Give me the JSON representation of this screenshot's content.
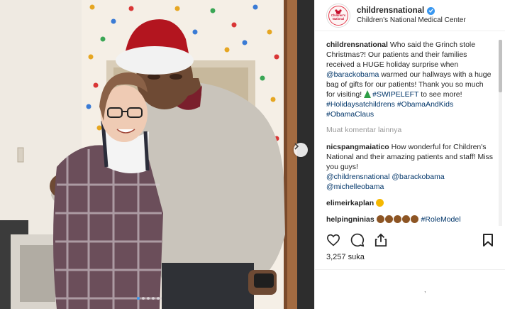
{
  "account": {
    "username": "childrensnational",
    "location": "Children's National Medical Center",
    "avatar_text": [
      "Children's",
      "National"
    ]
  },
  "caption": {
    "username": "childrensnational",
    "text_part1": "Who said the Grinch stole Christmas?! Our patients and their families received a HUGE holiday surprise when",
    "mention": "@barackobama",
    "text_part2": "warmed our hallways with a huge bag of gifts for our patients! Thank you so much for visiting!",
    "swipe_tag": "#SWIPELEFT",
    "text_part3": "to see more!",
    "hashtags": [
      "#Holidaysatchildrens",
      "#ObamaAndKids",
      "#ObamaClaus"
    ]
  },
  "load_more_label": "Muat komentar lainnya",
  "comments": [
    {
      "username": "nicspangmaiatico",
      "text": "How wonderful for Children's National and their amazing patients and staff! Miss you guys!",
      "mentions_line1": "@childrensnational @barackobama",
      "mentions_line2": "@michelleobama"
    },
    {
      "username": "elimeirkaplan"
    },
    {
      "username": "helpingninias",
      "hashtag": "#RoleModel"
    }
  ],
  "likes_label": "3,257 suka",
  "footer_glyph": ",",
  "icons": {
    "like": "heart-icon",
    "comment": "comment-bubble-icon",
    "share": "share-icon",
    "save": "bookmark-icon",
    "next": "chevron-right-icon",
    "verified": "verified-badge-icon"
  },
  "colors": {
    "link": "#003569",
    "verified": "#3897f0",
    "muted": "#999999",
    "santa_hat": "#b3151f"
  },
  "carousel": {
    "total": 5,
    "active": 0
  }
}
